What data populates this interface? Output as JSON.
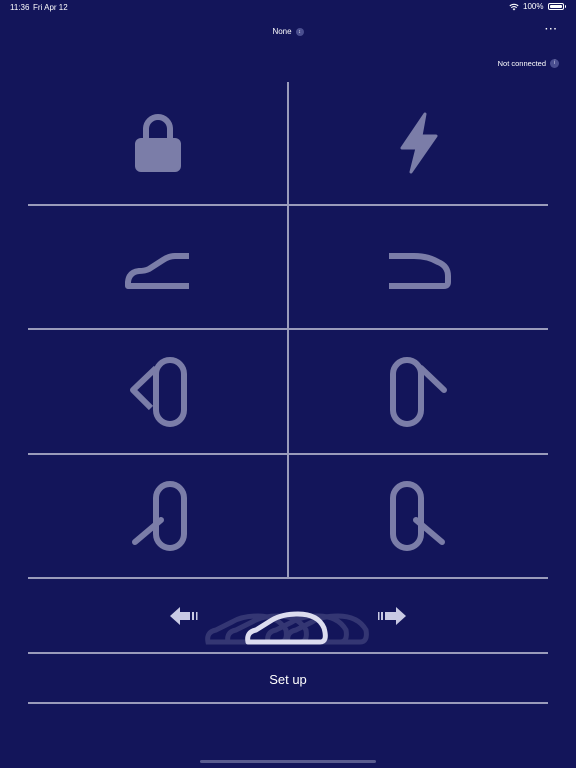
{
  "status_bar": {
    "time": "11:36",
    "date": "Fri Apr 12",
    "battery": "100%"
  },
  "header": {
    "vehicle_selection": "None",
    "more_label": "···",
    "connection_status": "Not connected",
    "info_label": "i"
  },
  "controls": {
    "grid_columns": 2,
    "icons": [
      "lock-icon",
      "lightning-icon",
      "front-trunk-icon",
      "rear-trunk-icon",
      "front-left-door-icon",
      "front-right-door-icon",
      "rear-left-door-icon",
      "rear-right-door-icon"
    ],
    "summon": {
      "icons": [
        "arrow-left-icon",
        "car-icon",
        "arrow-right-icon"
      ]
    }
  },
  "setup_label": "Set up",
  "colors": {
    "background": "#13155a",
    "divider": "#9a9bbb",
    "icon": "#7b7da8",
    "text": "#ffffff"
  }
}
